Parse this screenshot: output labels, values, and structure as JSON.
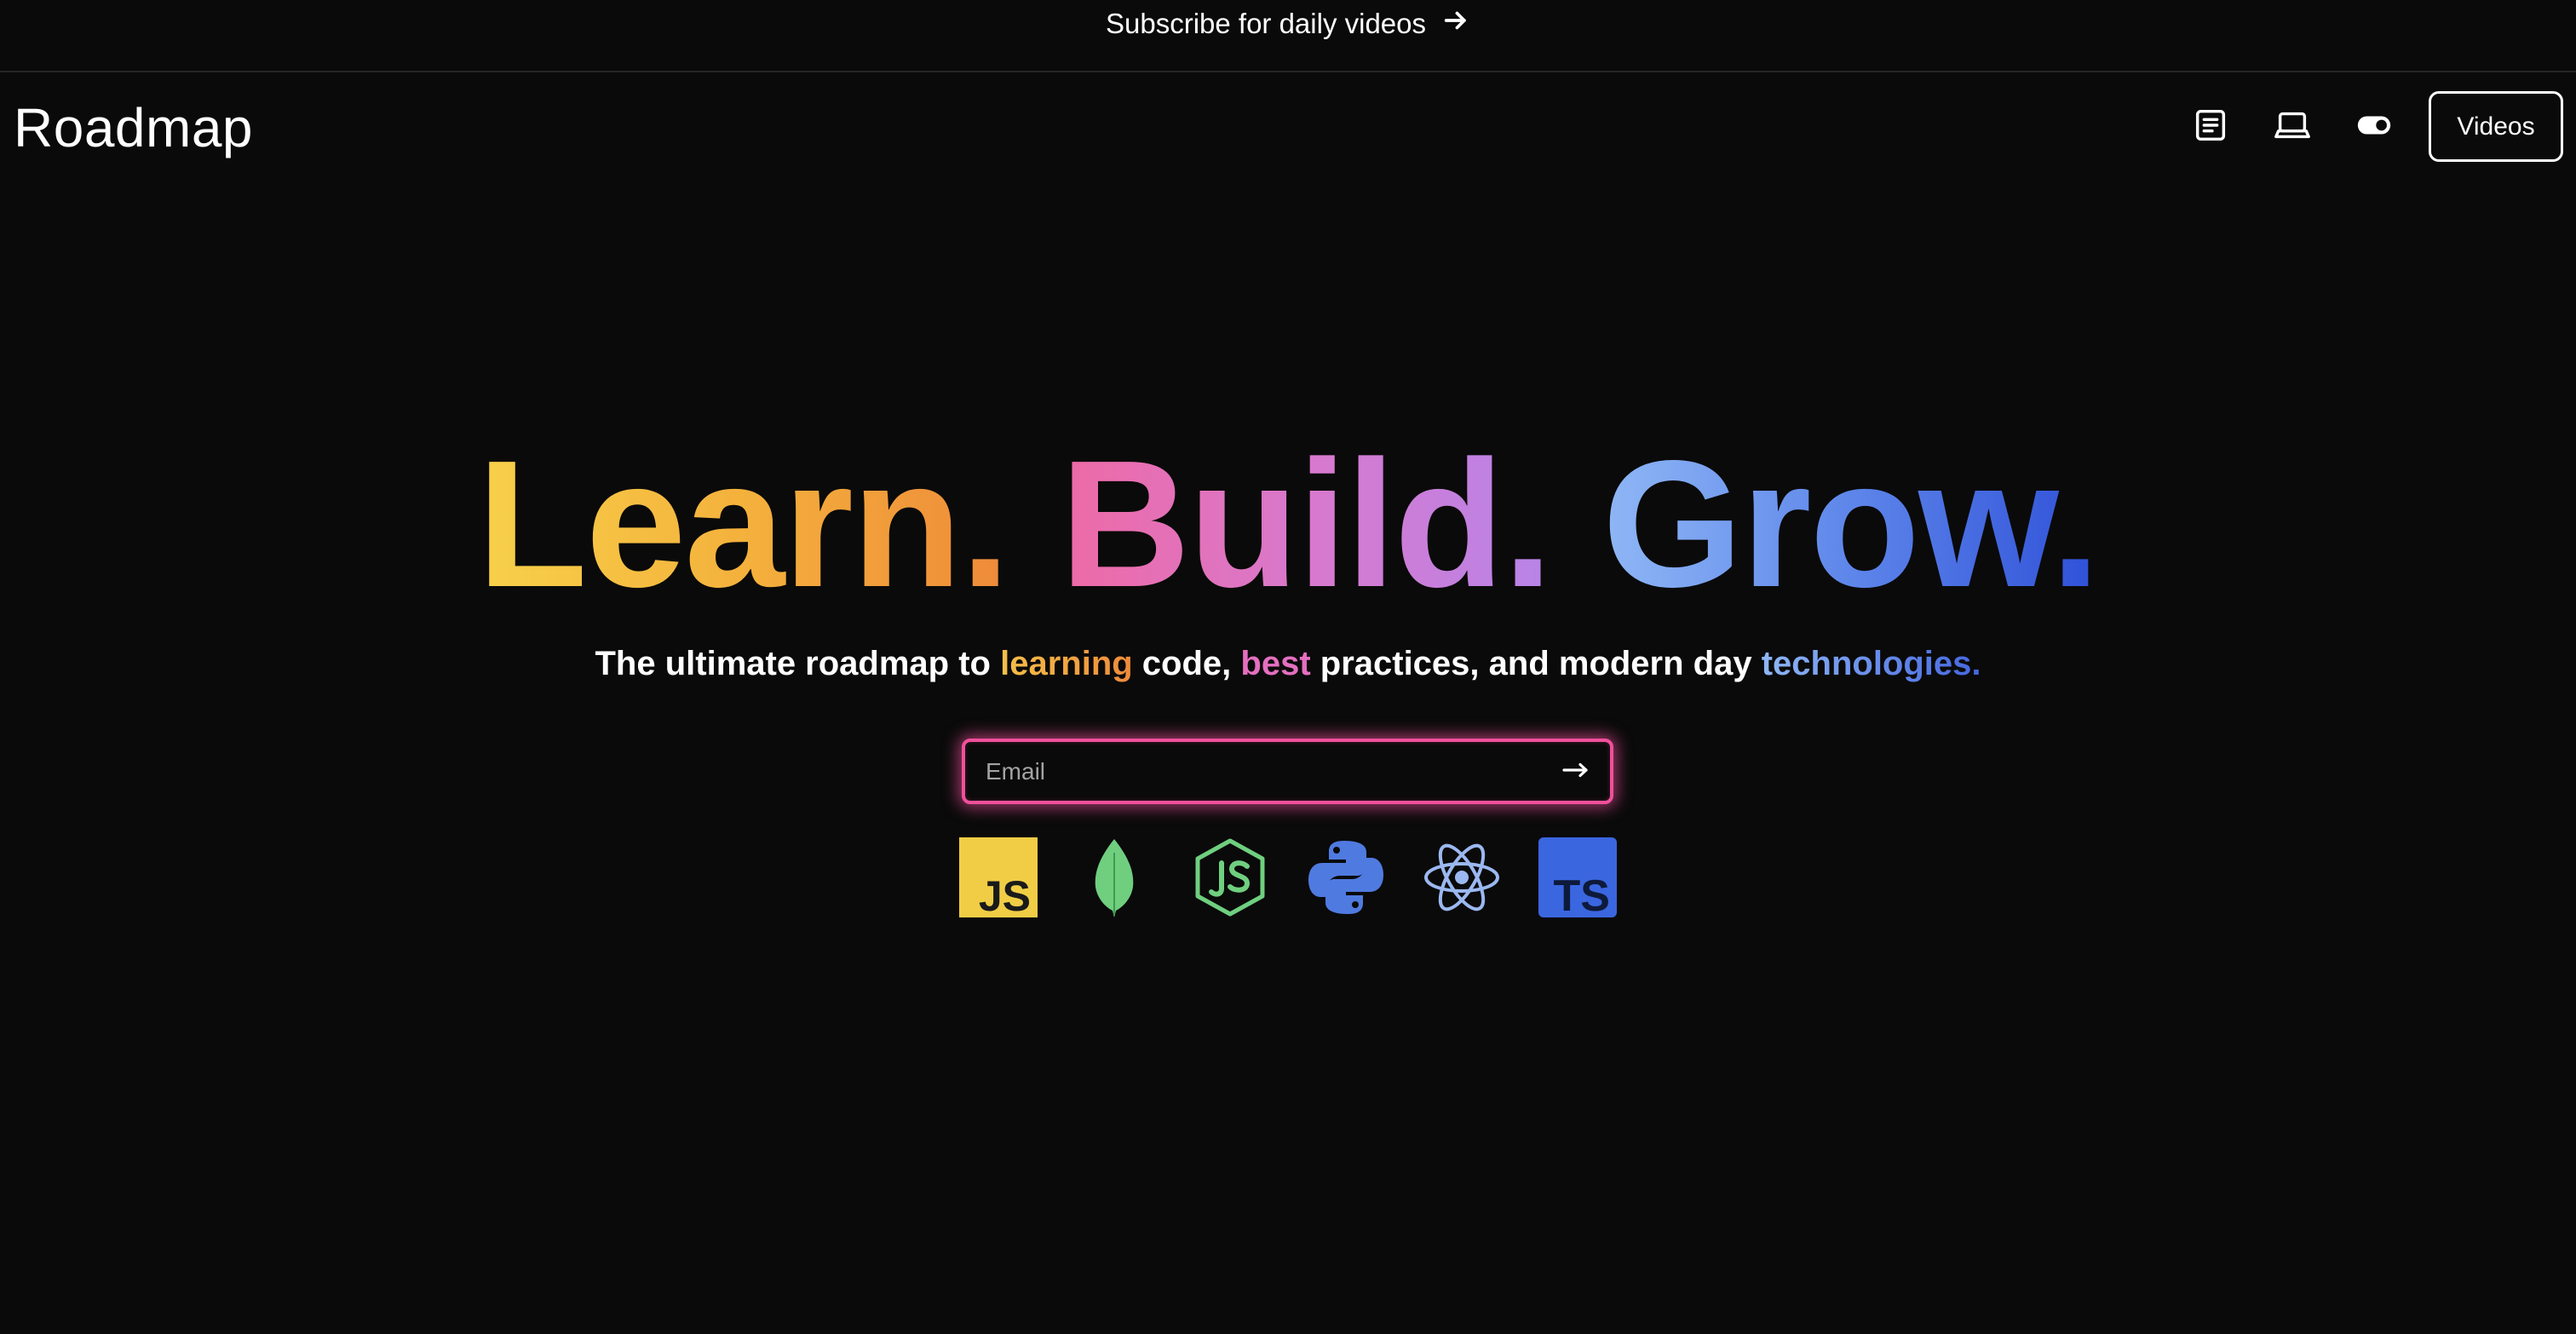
{
  "announcement": {
    "text": "Subscribe for daily videos",
    "icon": "arrow-right-icon"
  },
  "header": {
    "logo": "Roadmap",
    "icons": [
      "notes-icon",
      "laptop-icon",
      "toggle-icon"
    ],
    "videos_button": "Videos"
  },
  "hero": {
    "headline": {
      "word1": "Learn.",
      "word2": "Build.",
      "word3": "Grow."
    },
    "subtitle": {
      "part1": "The ultimate roadmap to ",
      "highlight1": "learning",
      "part2": " code, ",
      "highlight2": "best",
      "part3": " practices, and modern day ",
      "highlight3": "technologies."
    },
    "email": {
      "placeholder": "Email",
      "value": ""
    },
    "tech_icons": [
      "javascript-icon",
      "mongodb-icon",
      "nodejs-icon",
      "python-icon",
      "react-icon",
      "typescript-icon"
    ],
    "tech_labels": {
      "javascript": "JS",
      "typescript": "TS"
    }
  },
  "colors": {
    "background": "#0a0a0a",
    "learn_gradient": [
      "#f7d14a",
      "#ee8a3a"
    ],
    "build_gradient": [
      "#ee6aa6",
      "#b784e8"
    ],
    "grow_gradient": [
      "#8fb7f5",
      "#2f50d8"
    ],
    "email_glow": "#f0509b",
    "javascript": "#f0cd45",
    "mongodb": "#6fcf7f",
    "nodejs": "#6fcf7f",
    "python": "#4f7ae0",
    "react": "#9bb8f0",
    "typescript": "#3a66e0"
  }
}
